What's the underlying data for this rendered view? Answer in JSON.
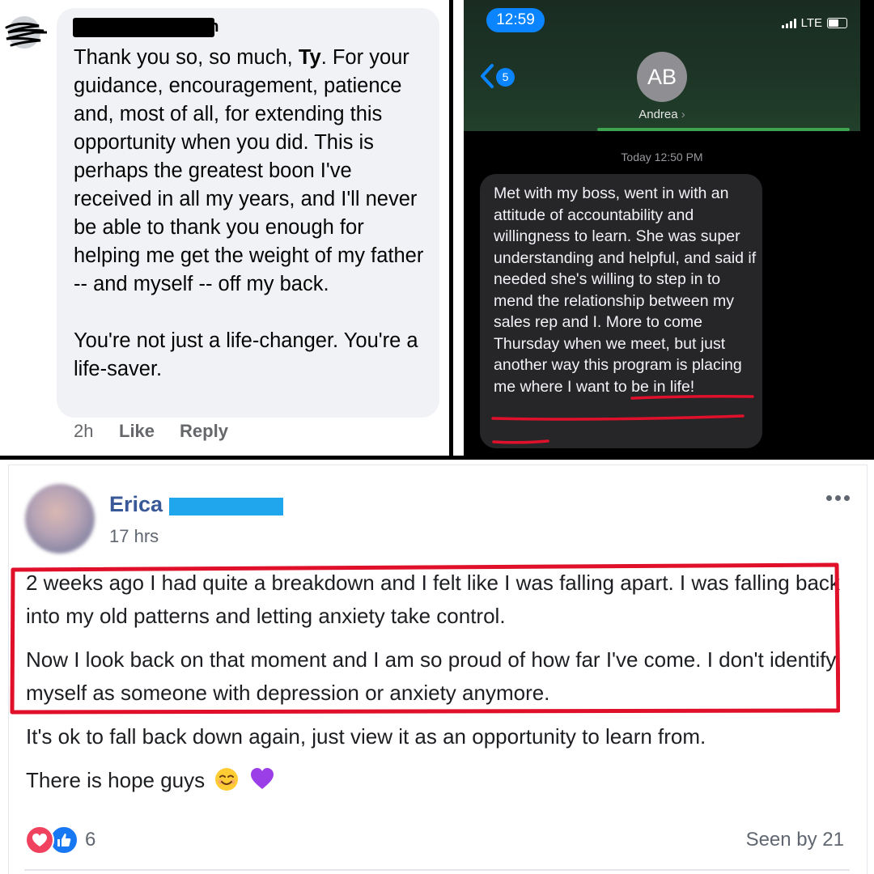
{
  "comment": {
    "name_suffix": "on",
    "text_line1_pre": "Thank you so, so much, ",
    "text_line1_bold": "Ty",
    "text_line1_post": ". For your guidance, encouragement, patience and, most of all, for extending this opportunity when you did. This is perhaps the greatest boon I've received in all my years, and I'll never be able to thank you enough for helping me get the weight of my father -- and myself -- off my back.",
    "text_para2": "You're not just a life-changer. You're a life-saver.",
    "time": "2h",
    "like_label": "Like",
    "reply_label": "Reply"
  },
  "imessage": {
    "clock": "12:59",
    "network": "LTE",
    "back_count": "5",
    "avatar_initials": "AB",
    "contact_name": "Andrea",
    "contact_chevron": "›",
    "date_label": "Today 12:50 PM",
    "message": "Met with my boss, went in with an attitude of accountability and willingness to learn. She was super understanding and helpful, and said if needed she's willing to step in to mend the relationship between my sales rep and I. More to come Thursday when we meet, but just another way this program is placing me where I want to be in life!",
    "accent_color": "#0a84ff",
    "underline_color": "#e0102a"
  },
  "post": {
    "author_first": "Erica",
    "time": "17 hrs",
    "para1": "2 weeks ago I had quite a breakdown and I felt like I was falling apart. I was falling back into my old patterns and letting anxiety take control.",
    "para2": "Now I look back on that moment and I am so proud of how far I've come. I don't identify myself as someone with depression or anxiety anymore.",
    "para3": "It's ok to fall back down again, just view it as an opportunity to learn from.",
    "para4": "There is hope guys",
    "emojis": [
      "smiling-face-icon",
      "purple-heart-icon"
    ],
    "reaction_count": "6",
    "seen_by": "Seen by 21",
    "name_color": "#385898",
    "highlight_color": "#e0102a"
  }
}
